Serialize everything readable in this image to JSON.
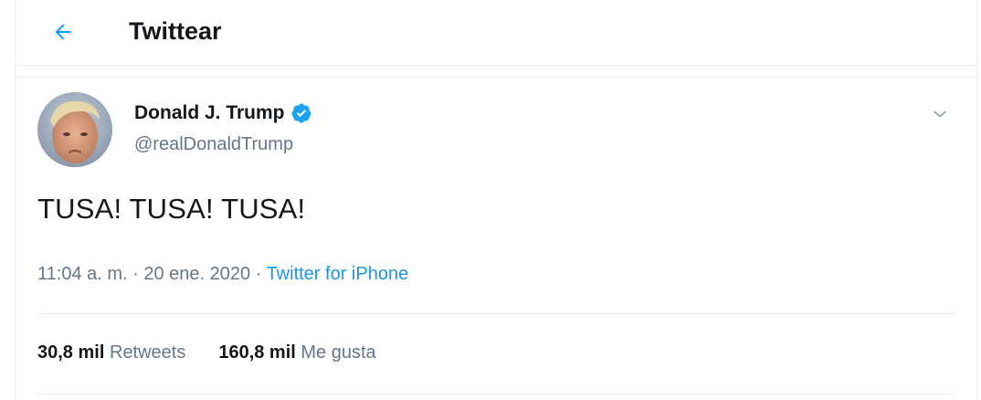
{
  "header": {
    "back_icon": "arrow-left-icon",
    "title": "Twittear"
  },
  "tweet": {
    "author": {
      "name": "Donald J. Trump",
      "handle": "@realDonaldTrump",
      "verified": true,
      "verified_icon": "verified-badge-icon",
      "avatar": "profile-photo"
    },
    "menu_icon": "chevron-down-icon",
    "text": "TUSA! TUSA! TUSA!",
    "time": "11:04 a. m.",
    "separator_1": " · ",
    "date": "20 ene. 2020",
    "separator_2": " · ",
    "source": "Twitter for iPhone",
    "retweets": {
      "count": "30,8 mil",
      "label": " Retweets"
    },
    "likes": {
      "count": "160,8 mil",
      "label": " Me gusta"
    }
  },
  "colors": {
    "accent": "#1da1f2",
    "link": "#1b95e0",
    "text": "#14171a",
    "secondary_text": "#657786",
    "border": "#e6ecf0"
  }
}
